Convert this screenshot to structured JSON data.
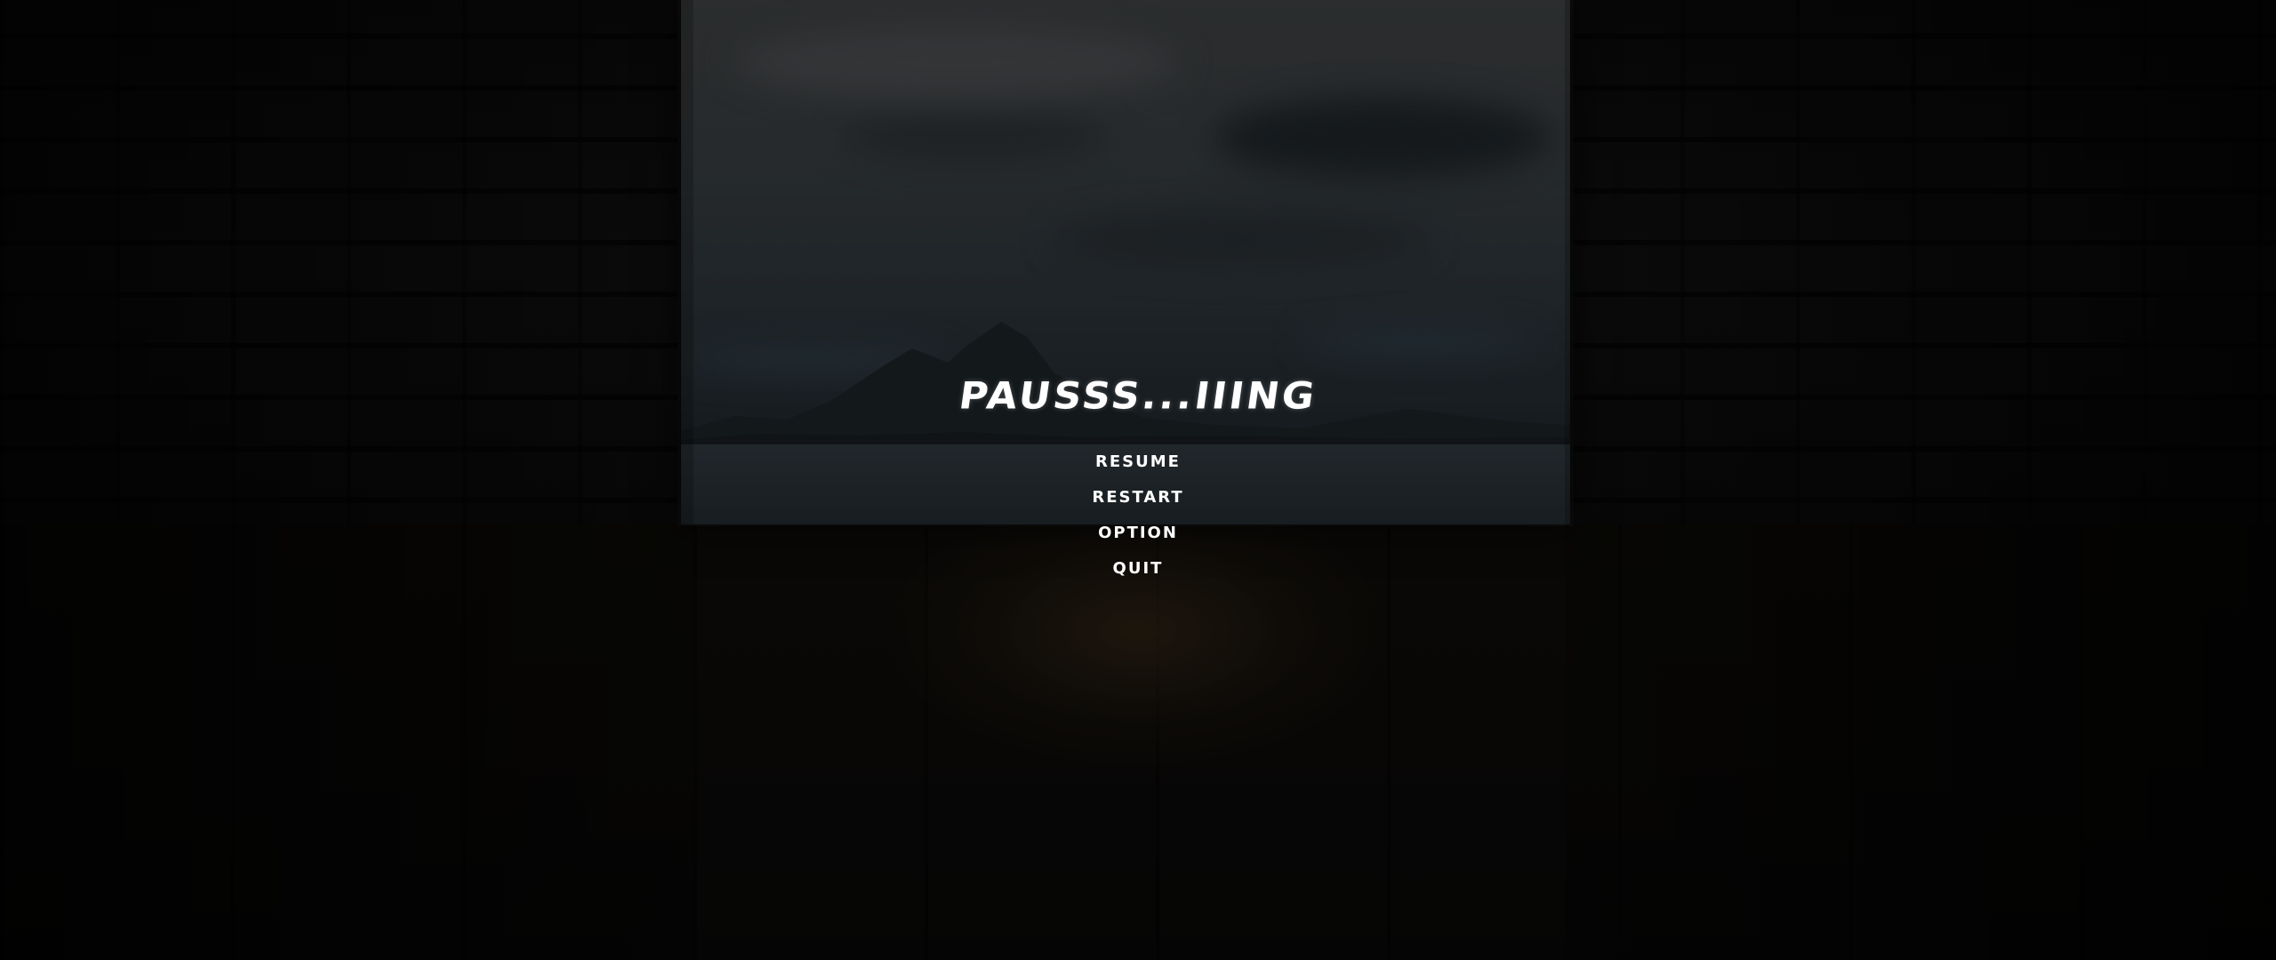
{
  "pause_menu": {
    "title": "PAUSSS...IIING",
    "items": [
      {
        "label": "RESUME"
      },
      {
        "label": "RESTART"
      },
      {
        "label": "OPTION"
      },
      {
        "label": "QUIT"
      }
    ]
  },
  "colors": {
    "text": "#ffffff",
    "background": "#060606",
    "backdrop_sky": "#3a3c3e",
    "floor_glow": "#3c2d19"
  }
}
